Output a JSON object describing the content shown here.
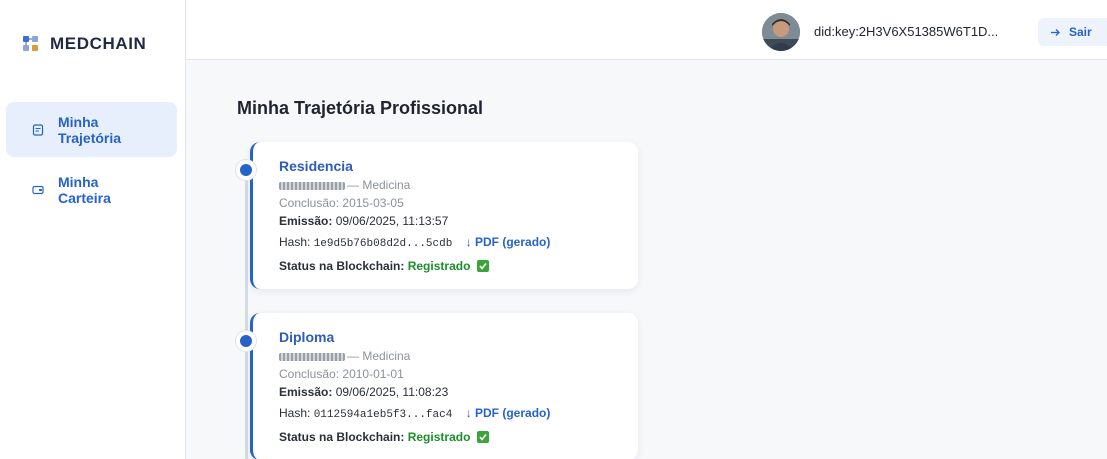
{
  "brand": {
    "name": "MEDCHAIN",
    "icon": "medchain-logo-icon"
  },
  "sidebar": {
    "items": [
      {
        "label": "Minha Trajetória",
        "icon": "document-icon",
        "active": true
      },
      {
        "label": "Minha Carteira",
        "icon": "wallet-icon",
        "active": false
      }
    ]
  },
  "topbar": {
    "did": "did:key:2H3V6X51385W6T1D...",
    "logout_label": "Sair",
    "logout_icon": "logout-arrow-icon"
  },
  "main": {
    "title": "Minha Trajetória Profissional",
    "entries": [
      {
        "title": "Residencia",
        "course": "— Medicina",
        "conclusion_label": "Conclusão:",
        "conclusion": "2015-03-05",
        "issue_label": "Emissão:",
        "issue": "09/06/2025, 11:13:57",
        "hash_label": "Hash:",
        "hash": "1e9d5b76b08d2d...5cdb",
        "pdf_label": "PDF (gerado)",
        "status_label": "Status na Blockchain:",
        "status": "Registrado"
      },
      {
        "title": "Diploma",
        "course": "— Medicina",
        "conclusion_label": "Conclusão:",
        "conclusion": "2010-01-01",
        "issue_label": "Emissão:",
        "issue": "09/06/2025, 11:08:23",
        "hash_label": "Hash:",
        "hash": "0112594a1eb5f3...fac4",
        "pdf_label": "PDF (gerado)",
        "status_label": "Status na Blockchain:",
        "status": "Registrado"
      }
    ]
  },
  "colors": {
    "accent": "#2563c9",
    "success": "#1a8f2c",
    "active_bg": "#e8effc"
  }
}
